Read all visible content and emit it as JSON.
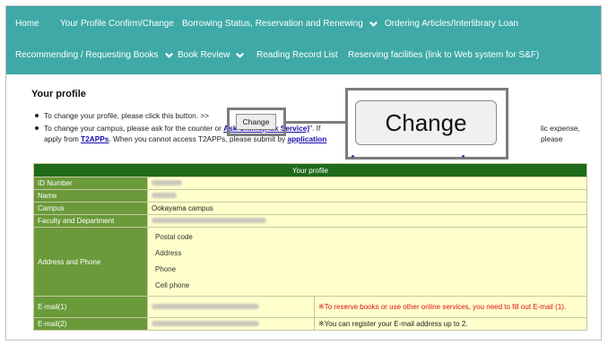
{
  "nav": {
    "row1": [
      {
        "label": "Home",
        "dropdown": false
      },
      {
        "label": "Your Profile Confirm/Change",
        "dropdown": false
      },
      {
        "label": "Borrowing Status, Reservation and Renewing",
        "dropdown": true
      },
      {
        "label": "Ordering Articles/Interlibrary Loan",
        "dropdown": false
      }
    ],
    "row2": [
      {
        "label": "Recommending / Requesting Books",
        "dropdown": true
      },
      {
        "label": "Book Review",
        "dropdown": true
      },
      {
        "label": "Reading Record List",
        "dropdown": false
      },
      {
        "label": "Reserving facilities (link to Web system for S&F)",
        "dropdown": false
      }
    ]
  },
  "page": {
    "title": "Your profile",
    "bullet1_text": "To change your profile, please click this button. >>",
    "bullet2_prefix": "To change your campus, please ask for the counter or ",
    "bullet2_link1": "Ask Online(Ask Service)",
    "bullet2_mid": "\". If",
    "bullet2_tail": "lic expense, please",
    "bullet2_line2_prefix": "apply from ",
    "bullet2_link2": "T2APPs",
    "bullet2_line2_mid": ". When you cannot access T2APPs, please submit by ",
    "bullet2_link3": "application",
    "change_button_small": "Change",
    "change_button_big": "Change"
  },
  "table": {
    "header": "Your profile",
    "rows": {
      "id_label": "ID Number",
      "name_label": "Name",
      "campus_label": "Campus",
      "campus_value": "Ookayama campus",
      "faculty_label": "Faculty and Department",
      "address_label": "Address and Phone",
      "address_subfields": [
        "Postal code",
        "Address",
        "Phone",
        "Cell phone"
      ],
      "email1_label": "E-mail(1)",
      "email1_note": "※To reserve books or use other online services, you need to fill out E-mail (1).",
      "email2_label": "E-mail(2)",
      "email2_note": "※You can register your E-mail address up to 2."
    }
  },
  "colors": {
    "nav_bg": "#3ea9a6",
    "table_header_bg": "#1f6b1a",
    "label_bg": "#6a9a39",
    "value_bg": "#ffffcc",
    "note_red": "#dd1111"
  }
}
